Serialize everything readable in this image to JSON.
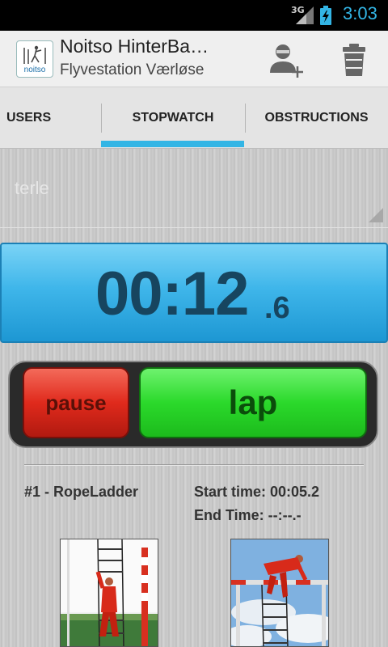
{
  "status_bar": {
    "network": "3G",
    "time": "3:03"
  },
  "action_bar": {
    "app_icon": "noitso-logo-icon",
    "icon_brand": "noitso",
    "title": "Noitso HinterBa…",
    "subtitle": "Flyvestation Værløse",
    "add_user_icon": "add-user-icon",
    "delete_icon": "trash-icon"
  },
  "tabs": [
    {
      "label": "USERS",
      "selected": false
    },
    {
      "label": "STOPWATCH",
      "selected": true
    },
    {
      "label": "OBSTRUCTIONS",
      "selected": false
    }
  ],
  "accent_color": "#33b5e5",
  "spinner": {
    "value": "terle"
  },
  "timer": {
    "main": "00:12",
    "tenths": ".6"
  },
  "controls": {
    "pause_label": "pause",
    "lap_label": "lap",
    "pause_color": "#e02a1c",
    "lap_color": "#2bd92b"
  },
  "obstacle": {
    "name": "#1 - RopeLadder",
    "start_time": "Start time: 00:05.2",
    "end_time": "End Time: --:--.-"
  },
  "photos": [
    {
      "name": "rope-ladder-climb-photo"
    },
    {
      "name": "rope-ladder-top-photo"
    }
  ]
}
